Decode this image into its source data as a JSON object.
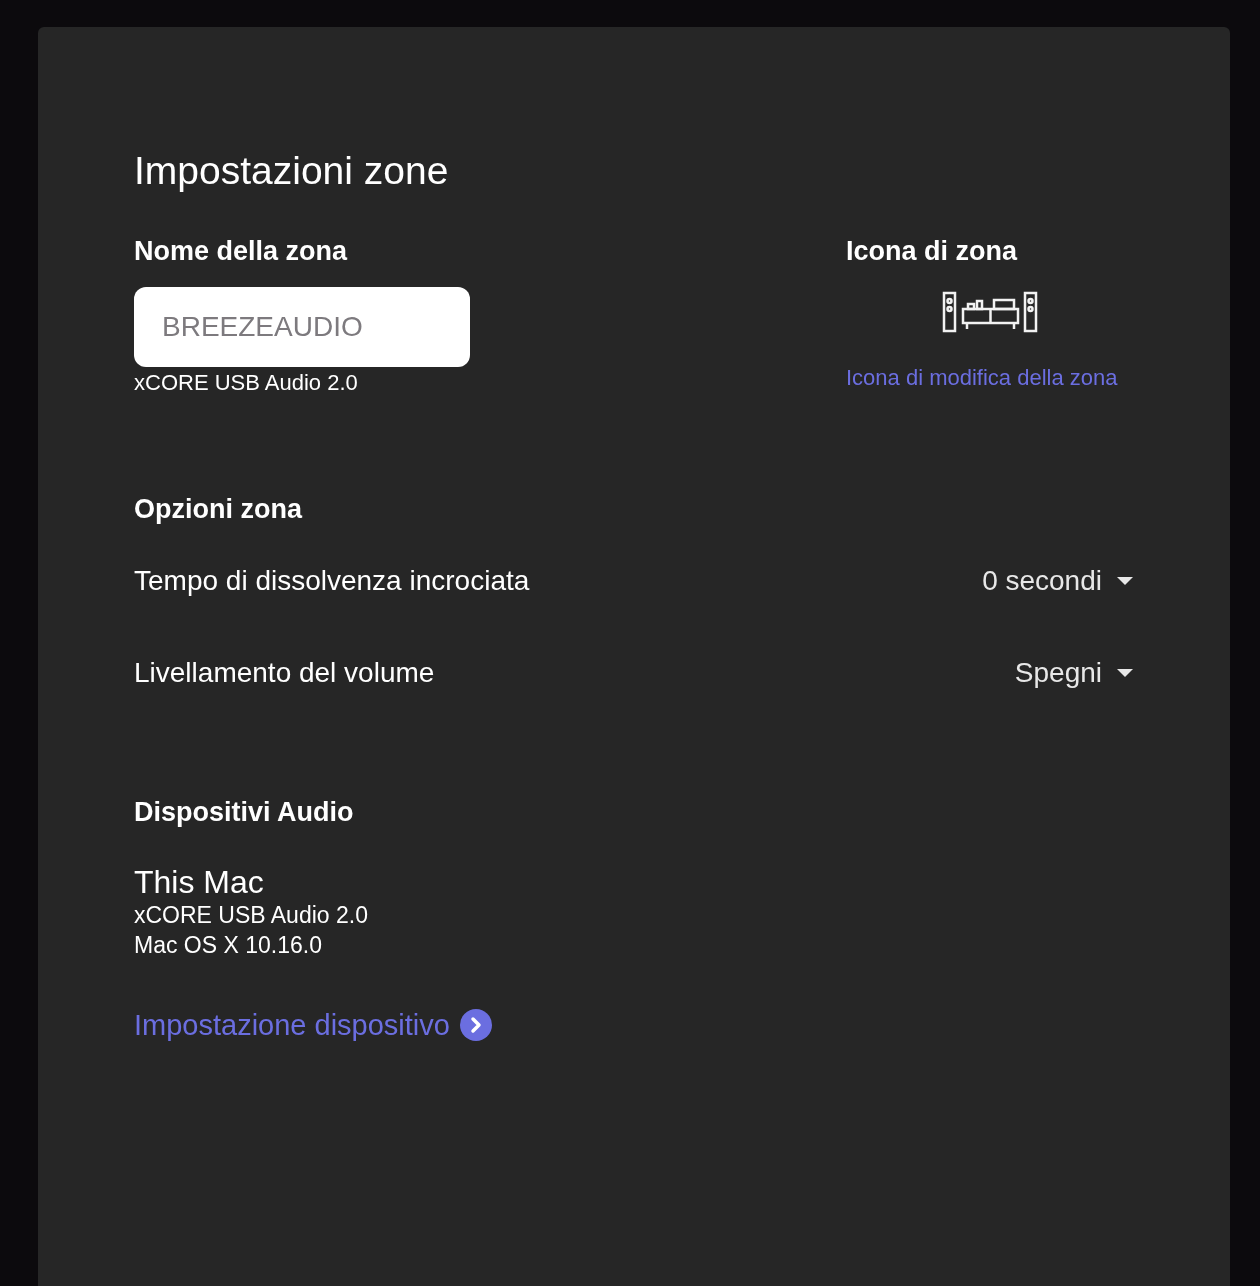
{
  "title": "Impostazioni zone",
  "zone_name": {
    "label": "Nome della zona",
    "placeholder": "BREEZEAUDIO",
    "device": "xCORE USB Audio 2.0"
  },
  "zone_icon": {
    "label": "Icona di zona",
    "link": "Icona di modifica della zona"
  },
  "zone_options": {
    "heading": "Opzioni zona",
    "rows": [
      {
        "label": "Tempo di dissolvenza incrociata",
        "value": "0 secondi"
      },
      {
        "label": "Livellamento del volume",
        "value": "Spegni"
      }
    ]
  },
  "audio_devices": {
    "heading": "Dispositivi Audio",
    "name": "This Mac",
    "lines": [
      "xCORE USB Audio 2.0",
      "Mac OS X 10.16.0"
    ],
    "link": "Impostazione dispositivo"
  }
}
